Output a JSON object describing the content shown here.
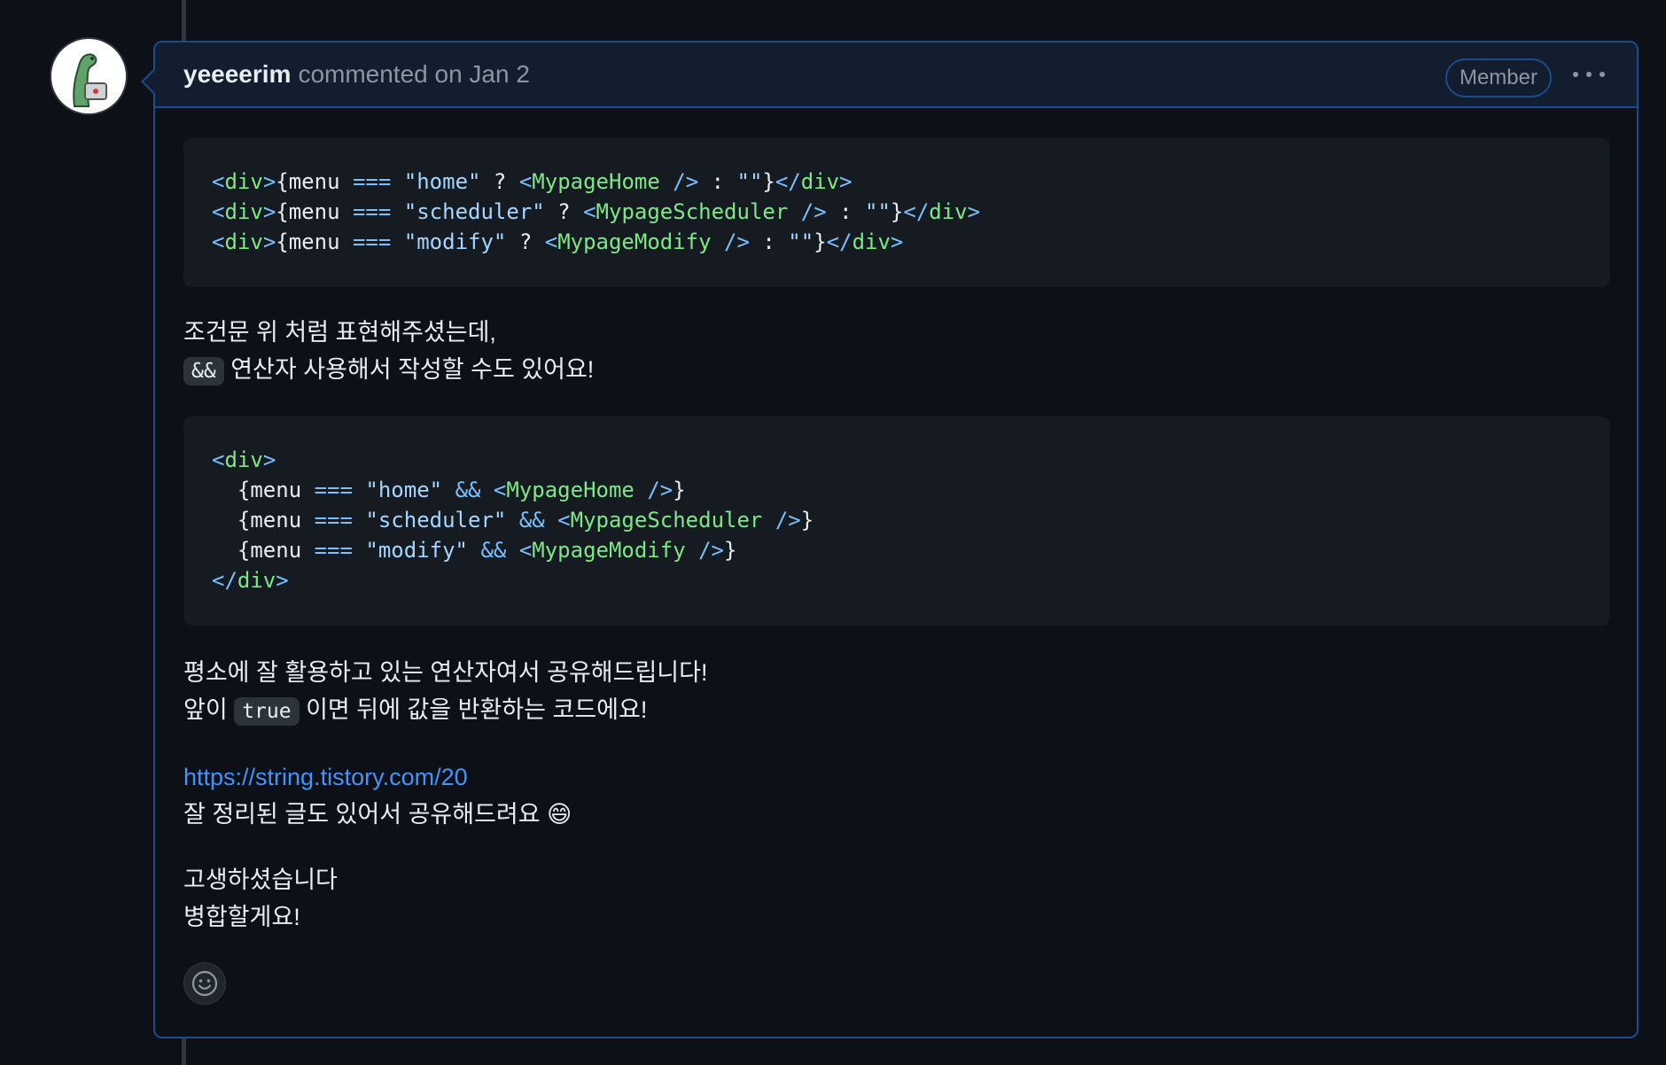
{
  "comment": {
    "author": "yeeeerim",
    "meta": "commented on Jan 2",
    "badge": "Member"
  },
  "code1": {
    "lines": [
      {
        "cond": "\"home\"",
        "comp": "MypageHome"
      },
      {
        "cond": "\"scheduler\"",
        "comp": "MypageScheduler"
      },
      {
        "cond": "\"modify\"",
        "comp": "MypageModify"
      }
    ]
  },
  "para1": {
    "line1": "조건문 위 처럼 표현해주셨는데,",
    "inline_code": "&&",
    "line2_rest": " 연산자 사용해서 작성할 수도 있어요!"
  },
  "code2": {
    "lines": [
      {
        "cond": "\"home\"",
        "comp": "MypageHome"
      },
      {
        "cond": "\"scheduler\"",
        "comp": "MypageScheduler"
      },
      {
        "cond": "\"modify\"",
        "comp": "MypageModify"
      }
    ]
  },
  "para2": {
    "line1": "평소에 잘 활용하고 있는 연산자여서 공유해드립니다!",
    "line2_pre": "앞이 ",
    "inline_code": "true",
    "line2_rest": " 이면 뒤에 값을 반환하는 코드에요!"
  },
  "para3": {
    "link": "https://string.tistory.com/20",
    "line2": "잘 정리된 글도 있어서 공유해드려요 😄"
  },
  "para4": {
    "line1": "고생하셨습니다",
    "line2": "병합할게요!"
  },
  "icons": {
    "avatar": "dinosaur-avatar-icon",
    "more": "kebab-icon",
    "reaction": "smiley-icon"
  }
}
